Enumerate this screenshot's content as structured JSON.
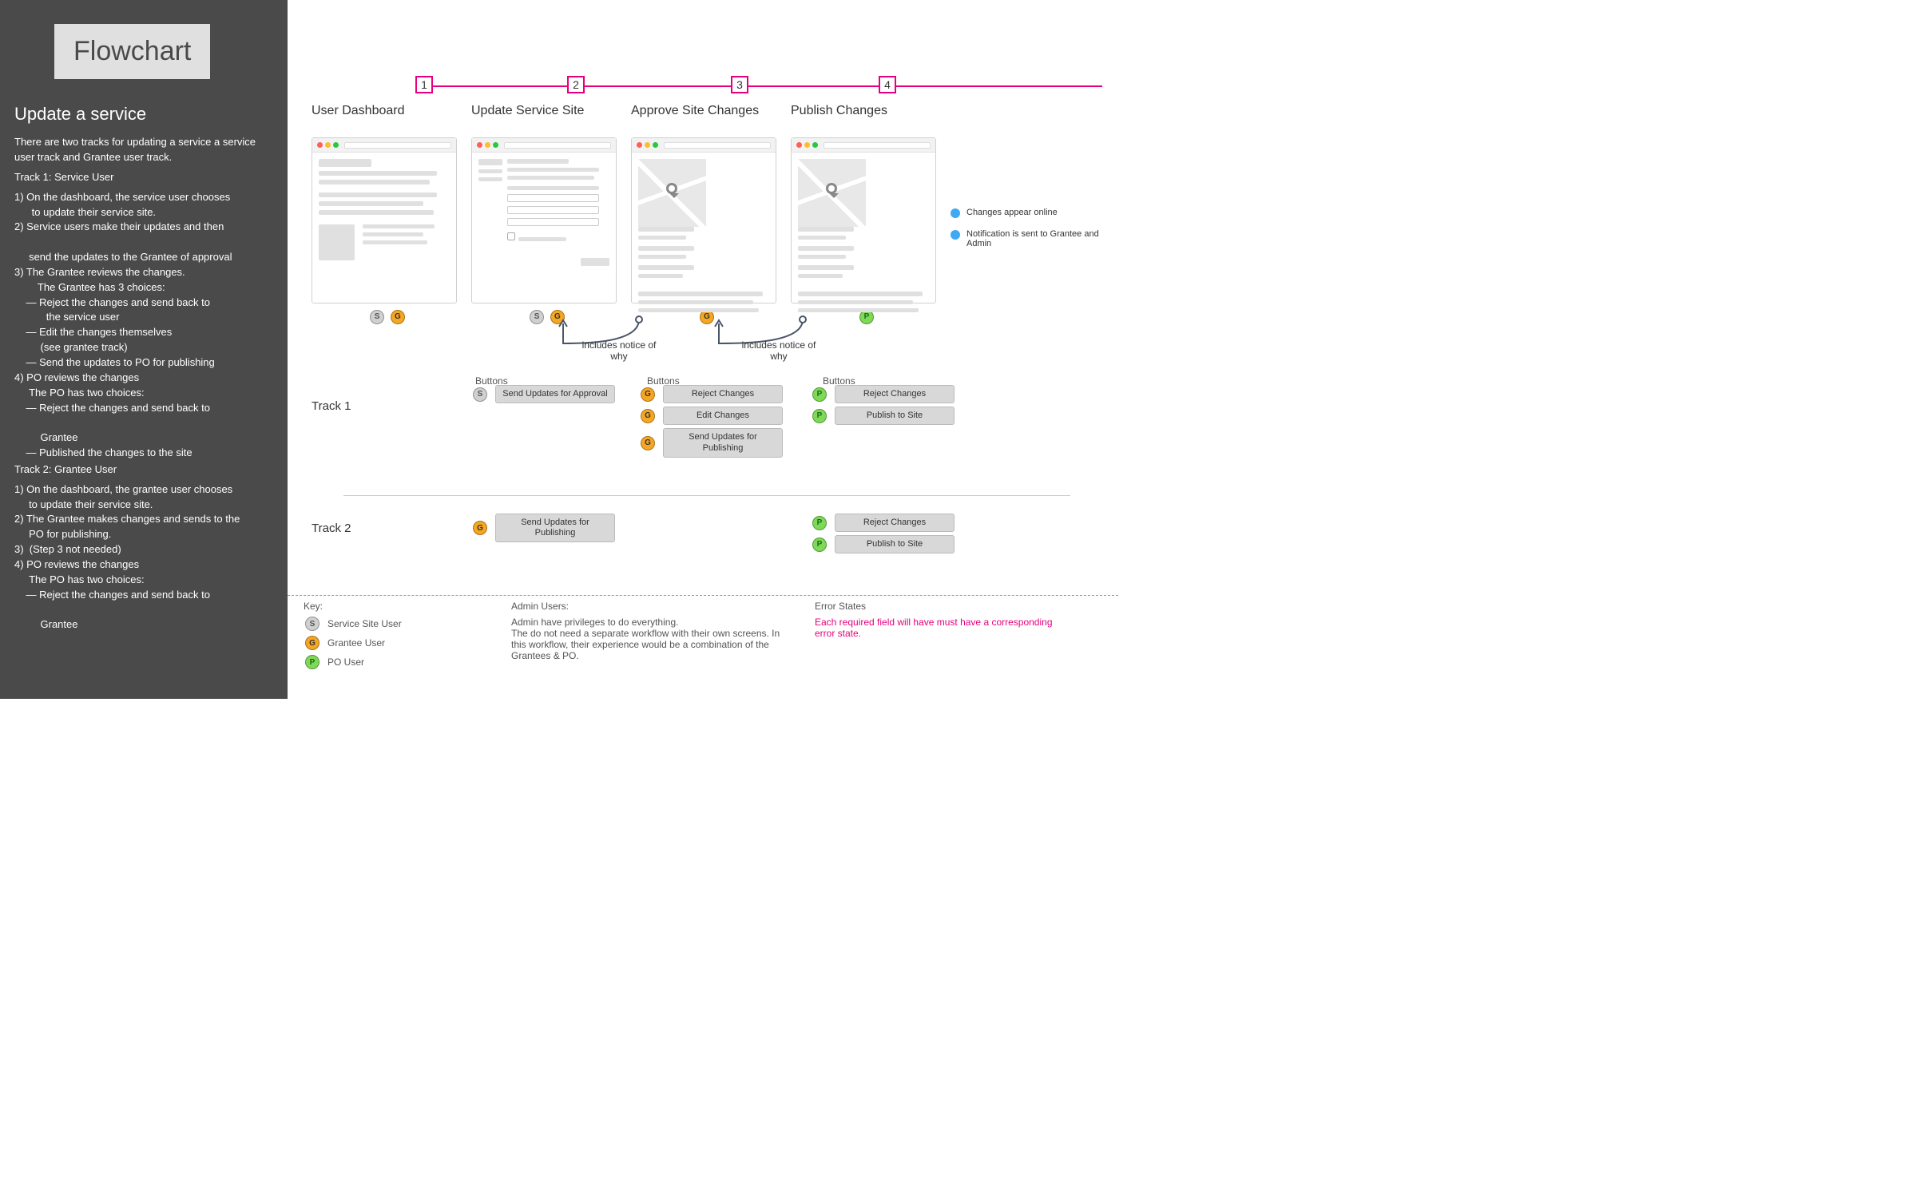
{
  "sidebar": {
    "title": "Flowchart",
    "heading": "Update a service",
    "intro": "There are two tracks for updating a service a service user track and Grantee user track.",
    "track1_label": "Track 1: Service User",
    "track1_steps": "1) On the dashboard, the service user chooses\n      to update their service site.\n2) Service users make their updates and then\n\n     send the updates to the Grantee of approval\n3) The Grantee reviews the changes.\n        The Grantee has 3 choices:\n    — Reject the changes and send back to\n           the service user\n    — Edit the changes themselves\n         (see grantee track)\n    — Send the updates to PO for publishing\n4) PO reviews the changes\n     The PO has two choices:\n    — Reject the changes and send back to\n\n         Grantee\n    — Published the changes to the site",
    "track2_label": "Track 2: Grantee User",
    "track2_steps": "1) On the dashboard, the grantee user chooses\n     to update their service site.\n2) The Grantee makes changes and sends to the\n     PO for publishing.\n3)  (Step 3 not needed)\n4) PO reviews the changes\n     The PO has two choices:\n    — Reject the changes and send back to\n\n         Grantee"
  },
  "steps": [
    "1",
    "2",
    "3",
    "4"
  ],
  "columns": [
    {
      "title": "User Dashboard",
      "roles": [
        "S",
        "G"
      ],
      "variant": "dashboard"
    },
    {
      "title": "Update Service Site",
      "roles": [
        "S",
        "G"
      ],
      "variant": "form"
    },
    {
      "title": "Approve Site Changes",
      "roles": [
        "G"
      ],
      "variant": "map"
    },
    {
      "title": "Publish Changes",
      "roles": [
        "P"
      ],
      "variant": "map"
    }
  ],
  "annotations": {
    "notice1": "includes notice of why",
    "notice2": "includes notice of why"
  },
  "mini_legend": [
    "Changes appear online",
    "Notification is sent to Grantee and Admin"
  ],
  "buttons_header": "Buttons",
  "track1_label": "Track 1",
  "track2_label": "Track 2",
  "track1": {
    "col2": [
      {
        "role": "S",
        "label": "Send Updates for Approval"
      }
    ],
    "col3": [
      {
        "role": "G",
        "label": "Reject Changes"
      },
      {
        "role": "G",
        "label": "Edit Changes"
      },
      {
        "role": "G",
        "label": "Send Updates for Publishing"
      }
    ],
    "col4": [
      {
        "role": "P",
        "label": "Reject Changes"
      },
      {
        "role": "P",
        "label": "Publish to Site"
      }
    ]
  },
  "track2": {
    "col2": [
      {
        "role": "G",
        "label": "Send Updates for Publishing"
      }
    ],
    "col4": [
      {
        "role": "P",
        "label": "Reject Changes"
      },
      {
        "role": "P",
        "label": "Publish to Site"
      }
    ]
  },
  "footer": {
    "key_title": "Key:",
    "key_items": [
      {
        "role": "S",
        "label": "Service Site User"
      },
      {
        "role": "G",
        "label": "Grantee User"
      },
      {
        "role": "P",
        "label": "PO User"
      }
    ],
    "admin_title": "Admin Users:",
    "admin_text": "Admin have privileges to do everything.\nThe do not need a separate workflow with their own screens. In this workflow, their experience would be a combination of the Grantees & PO.",
    "error_title": "Error States",
    "error_text": "Each required field will have must have a corresponding error state."
  }
}
